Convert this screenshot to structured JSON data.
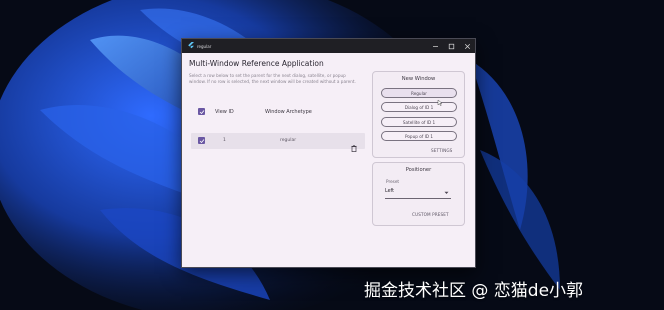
{
  "window": {
    "title": "regular"
  },
  "app": {
    "title": "Multi-Window Reference Application",
    "instructions": "Select a row below to set the parent for the next dialog, satellite, or popup window. If no row is selected, the next window will be created without a parent."
  },
  "table": {
    "headers": {
      "view_id": "View ID",
      "archetype": "Window Archetype"
    },
    "rows": [
      {
        "view_id": "1",
        "archetype": "regular"
      }
    ]
  },
  "new_window": {
    "title": "New Window",
    "buttons": [
      "Regular",
      "Dialog of ID 1",
      "Satellite of ID 1",
      "Popup of ID 1"
    ],
    "settings_label": "SETTINGS"
  },
  "positioner": {
    "title": "Positioner",
    "preset_label": "Preset",
    "preset_value": "Left",
    "custom_label": "CUSTOM PRESET"
  },
  "watermark": "掘金技术社区 @ 恋猫de小郭",
  "colors": {
    "accent": "#6a57a3",
    "window_bg": "#f6eff7",
    "titlebar": "#1f1f24"
  }
}
